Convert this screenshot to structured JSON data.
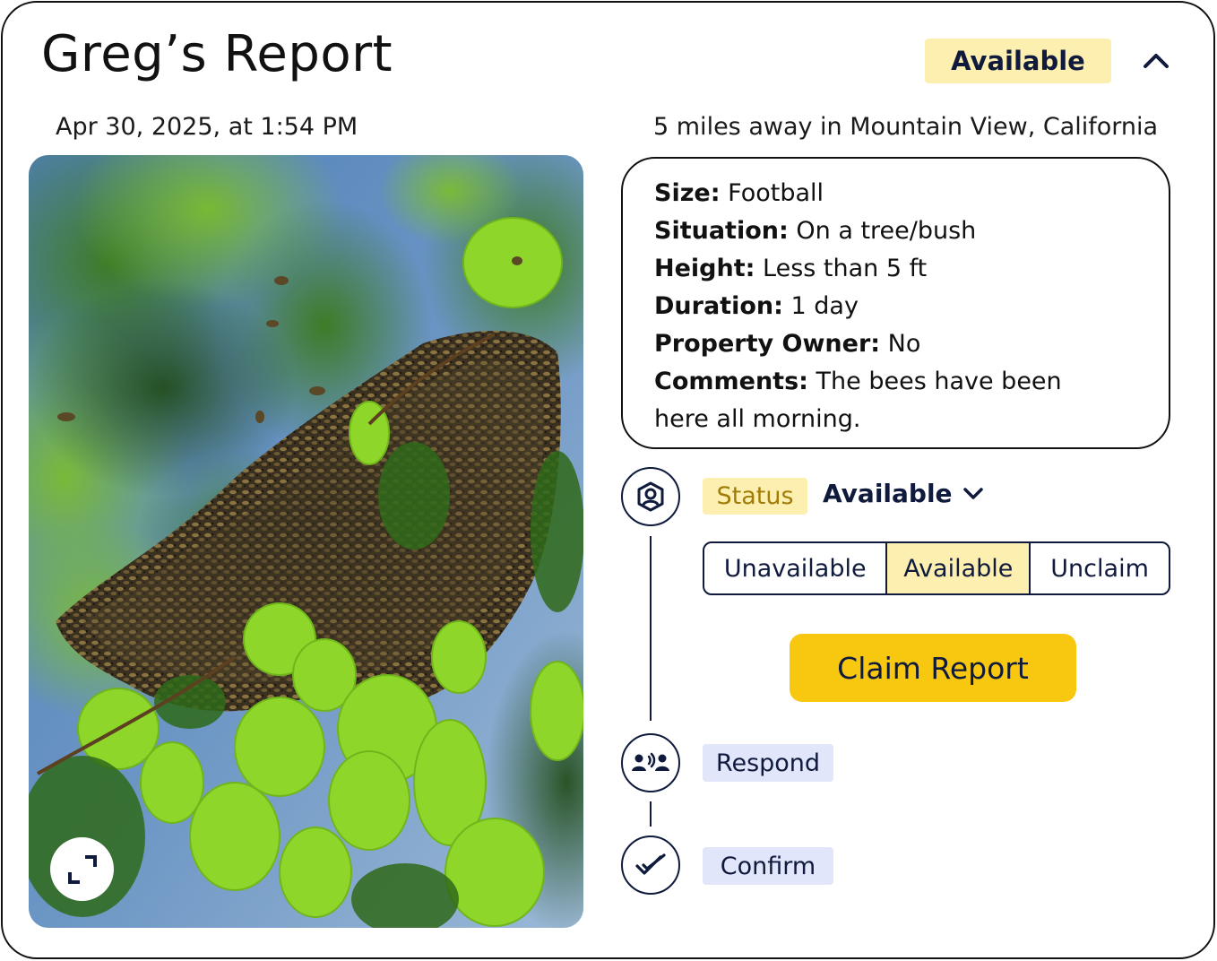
{
  "report": {
    "title": "Greg’s Report",
    "badge": "Available",
    "date": "Apr 30, 2025, at 1:54 PM",
    "location": "5 miles away in Mountain View, California"
  },
  "details": {
    "size_label": "Size:",
    "size_value": "Football",
    "situation_label": "Situation:",
    "situation_value": "On a tree/bush",
    "height_label": "Height:",
    "height_value": "Less than 5 ft",
    "duration_label": "Duration:",
    "duration_value": "1 day",
    "owner_label": "Property Owner:",
    "owner_value": "No",
    "comments_label": "Comments:",
    "comments_value": "The bees have been here all morning."
  },
  "status": {
    "chip": "Status",
    "value": "Available",
    "options": [
      "Unavailable",
      "Available",
      "Unclaim"
    ],
    "selected": "Available"
  },
  "claim_button": "Claim Report",
  "steps": {
    "respond": "Respond",
    "confirm": "Confirm"
  },
  "colors": {
    "navy": "#0f1a3c",
    "badge_yellow": "#fcefb0",
    "claim_yellow": "#f7c80f",
    "step_blue": "#e1e6fb",
    "status_text": "#a07d08"
  },
  "icons": {
    "collapse": "chevron-up-icon",
    "expand": "expand-icon",
    "status_step": "location-pin-icon",
    "respond_step": "people-talking-icon",
    "confirm_step": "double-check-icon",
    "dropdown": "chevron-down-icon"
  }
}
